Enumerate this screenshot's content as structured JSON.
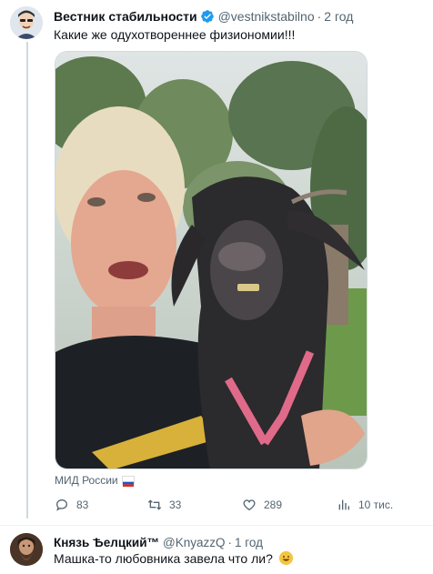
{
  "tweet": {
    "display_name": "Вестник стабильности",
    "handle": "@vestnikstabilno",
    "separator": "·",
    "time": "2 год",
    "text": "Какие же одухотвореннее физиономии!!!",
    "verified_icon": "verified-badge-icon",
    "source_label": "МИД России",
    "source_flag_icon": "russia-flag-icon",
    "actions": {
      "replies": "83",
      "retweets": "33",
      "likes": "289",
      "views": "10 тис."
    }
  },
  "reply": {
    "display_name": "Князь Ѣелцкий™",
    "handle": "@KnyazzQ",
    "separator": "·",
    "time": "1 год",
    "text": "Машка-то любовника завела что ли?",
    "emoji_icon": "grinning-face-icon"
  },
  "colors": {
    "verified": "#1d9bf0",
    "muted": "#536471",
    "thread_line": "#cfd9de",
    "text": "#0f1419"
  }
}
